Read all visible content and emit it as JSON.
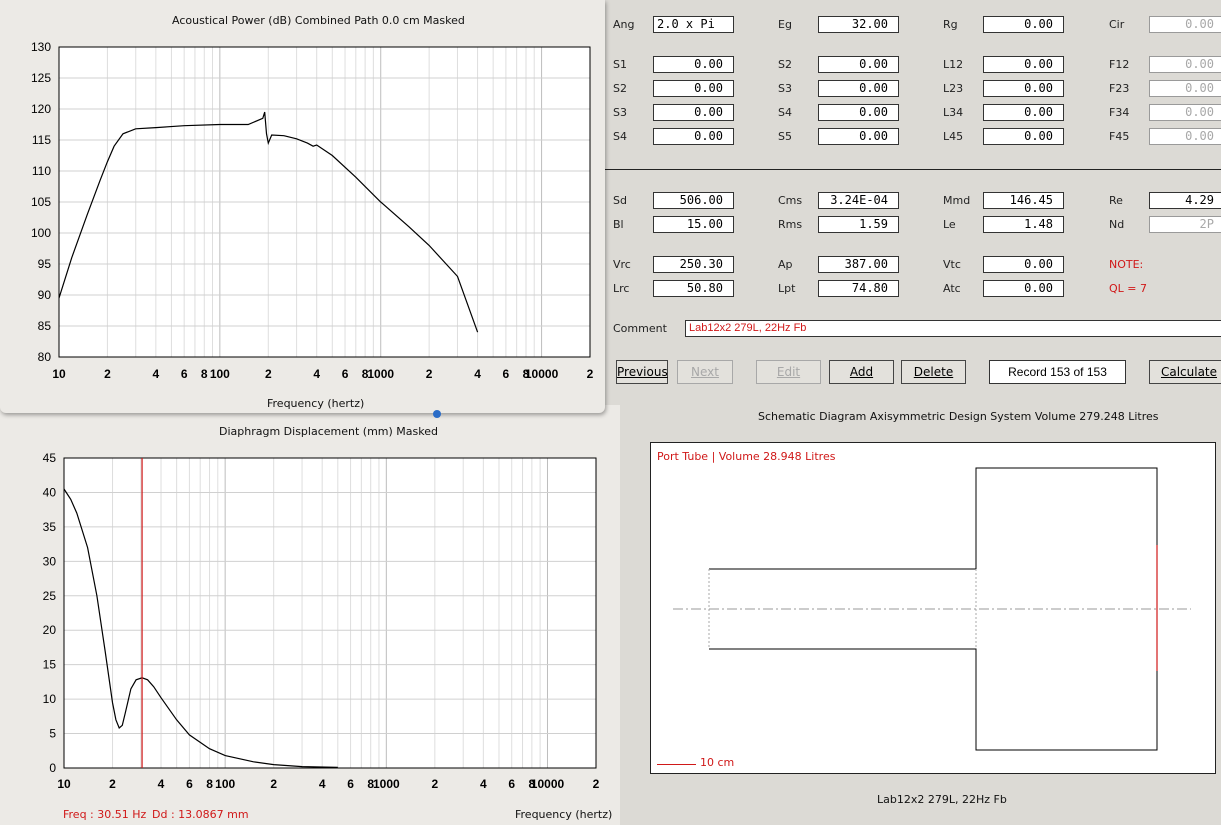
{
  "params": {
    "row1": [
      {
        "label": "Ang",
        "value": "2.0 x Pi",
        "align": "left",
        "disabled": false
      },
      {
        "label": "Eg",
        "value": "32.00",
        "disabled": false
      },
      {
        "label": "Rg",
        "value": "0.00",
        "disabled": false
      },
      {
        "label": "Cir",
        "value": "0.00",
        "disabled": true
      }
    ],
    "grid": [
      [
        {
          "label": "S1",
          "value": "0.00"
        },
        {
          "label": "S2",
          "value": "0.00"
        },
        {
          "label": "L12",
          "value": "0.00"
        },
        {
          "label": "F12",
          "value": "0.00",
          "disabled": true
        }
      ],
      [
        {
          "label": "S2",
          "value": "0.00"
        },
        {
          "label": "S3",
          "value": "0.00"
        },
        {
          "label": "L23",
          "value": "0.00"
        },
        {
          "label": "F23",
          "value": "0.00",
          "disabled": true
        }
      ],
      [
        {
          "label": "S3",
          "value": "0.00"
        },
        {
          "label": "S4",
          "value": "0.00"
        },
        {
          "label": "L34",
          "value": "0.00"
        },
        {
          "label": "F34",
          "value": "0.00",
          "disabled": true
        }
      ],
      [
        {
          "label": "S4",
          "value": "0.00"
        },
        {
          "label": "S5",
          "value": "0.00"
        },
        {
          "label": "L45",
          "value": "0.00"
        },
        {
          "label": "F45",
          "value": "0.00",
          "disabled": true
        }
      ]
    ],
    "driver": [
      [
        {
          "label": "Sd",
          "value": "506.00"
        },
        {
          "label": "Cms",
          "value": "3.24E-04"
        },
        {
          "label": "Mmd",
          "value": "146.45"
        },
        {
          "label": "Re",
          "value": "4.29"
        }
      ],
      [
        {
          "label": "Bl",
          "value": "15.00"
        },
        {
          "label": "Rms",
          "value": "1.59"
        },
        {
          "label": "Le",
          "value": "1.48"
        },
        {
          "label": "Nd",
          "value": "2P",
          "disabled": true
        }
      ]
    ],
    "box": [
      [
        {
          "label": "Vrc",
          "value": "250.30"
        },
        {
          "label": "Ap",
          "value": "387.00"
        },
        {
          "label": "Vtc",
          "value": "0.00"
        }
      ],
      [
        {
          "label": "Lrc",
          "value": "50.80"
        },
        {
          "label": "Lpt",
          "value": "74.80"
        },
        {
          "label": "Atc",
          "value": "0.00"
        }
      ]
    ],
    "note_label": "NOTE:",
    "note_text": "QL = 7"
  },
  "comment": {
    "label": "Comment",
    "value": "Lab12x2 279L, 22Hz Fb"
  },
  "buttons": {
    "previous": "Previous",
    "next": "Next",
    "edit": "Edit",
    "add": "Add",
    "delete": "Delete",
    "record": "Record 153 of 153",
    "calculate": "Calculate"
  },
  "schematic": {
    "title": "Schematic Diagram   Axisymmetric Design   System Volume 279.248 Litres",
    "port_label": "Port Tube | Volume 28.948 Litres",
    "scale_label": "10 cm",
    "caption": "Lab12x2 279L, 22Hz Fb",
    "colors": {
      "red": "#d01818"
    }
  },
  "charts": {
    "power": {
      "title": "Acoustical Power (dB)   Combined   Path 0.0 cm   Masked",
      "xlabel": "Frequency (hertz)",
      "x_ticks": [
        "10",
        "2",
        "4",
        "6",
        "8",
        "100",
        "2",
        "4",
        "6",
        "8",
        "1000",
        "2",
        "4",
        "6",
        "8",
        "10000",
        "2"
      ],
      "y_ticks": [
        "130",
        "125",
        "120",
        "115",
        "110",
        "105",
        "100",
        "95",
        "90",
        "85",
        "80"
      ]
    },
    "disp": {
      "title": "Diaphragm Displacement (mm)   Masked",
      "xlabel": "Frequency (hertz)",
      "x_ticks": [
        "10",
        "2",
        "4",
        "6",
        "8",
        "100",
        "2",
        "4",
        "6",
        "8",
        "1000",
        "2",
        "4",
        "6",
        "8",
        "10000",
        "2"
      ],
      "y_ticks": [
        "45",
        "40",
        "35",
        "30",
        "25",
        "20",
        "15",
        "10",
        "5",
        "0"
      ],
      "freq_readout": "Freq : 30.51 Hz",
      "disp_readout": "Dd : 13.0867 mm"
    }
  },
  "chart_data": [
    {
      "type": "line",
      "title": "Acoustical Power (dB)   Combined   Path 0.0 cm   Masked",
      "xlabel": "Frequency (hertz)",
      "ylabel": "",
      "xscale": "log",
      "xlim": [
        10,
        20000
      ],
      "ylim": [
        80,
        130
      ],
      "grid": true,
      "x": [
        10,
        12,
        15,
        18,
        20,
        22,
        25,
        30,
        40,
        60,
        100,
        150,
        185,
        190,
        195,
        200,
        210,
        250,
        300,
        350,
        380,
        400,
        500,
        700,
        1000,
        1500,
        2000,
        3000,
        4000
      ],
      "y": [
        89.5,
        96,
        103,
        108.5,
        111.5,
        114,
        116,
        116.8,
        117,
        117.3,
        117.5,
        117.5,
        118.5,
        119.5,
        116,
        114.5,
        115.8,
        115.7,
        115.2,
        114.5,
        114,
        114.2,
        112.5,
        109,
        105,
        101,
        98,
        93,
        84
      ]
    },
    {
      "type": "line",
      "title": "Diaphragm Displacement (mm)   Masked",
      "xlabel": "Frequency (hertz)",
      "ylabel": "",
      "xscale": "log",
      "xlim": [
        10,
        20000
      ],
      "ylim": [
        0,
        45
      ],
      "grid": true,
      "x": [
        10,
        11,
        12,
        14,
        16,
        18,
        20,
        21,
        22,
        23,
        24,
        26,
        28,
        30.5,
        33,
        36,
        40,
        50,
        60,
        80,
        100,
        150,
        200,
        300,
        500
      ],
      "y": [
        40.5,
        39,
        37,
        32,
        25,
        17,
        9.5,
        7,
        5.8,
        6.2,
        8,
        11.5,
        12.8,
        13.1,
        12.8,
        11.8,
        10.2,
        7,
        4.8,
        2.8,
        1.8,
        0.9,
        0.5,
        0.2,
        0.08
      ],
      "cursor_x": 30.51,
      "cursor_y": 13.0867
    }
  ]
}
